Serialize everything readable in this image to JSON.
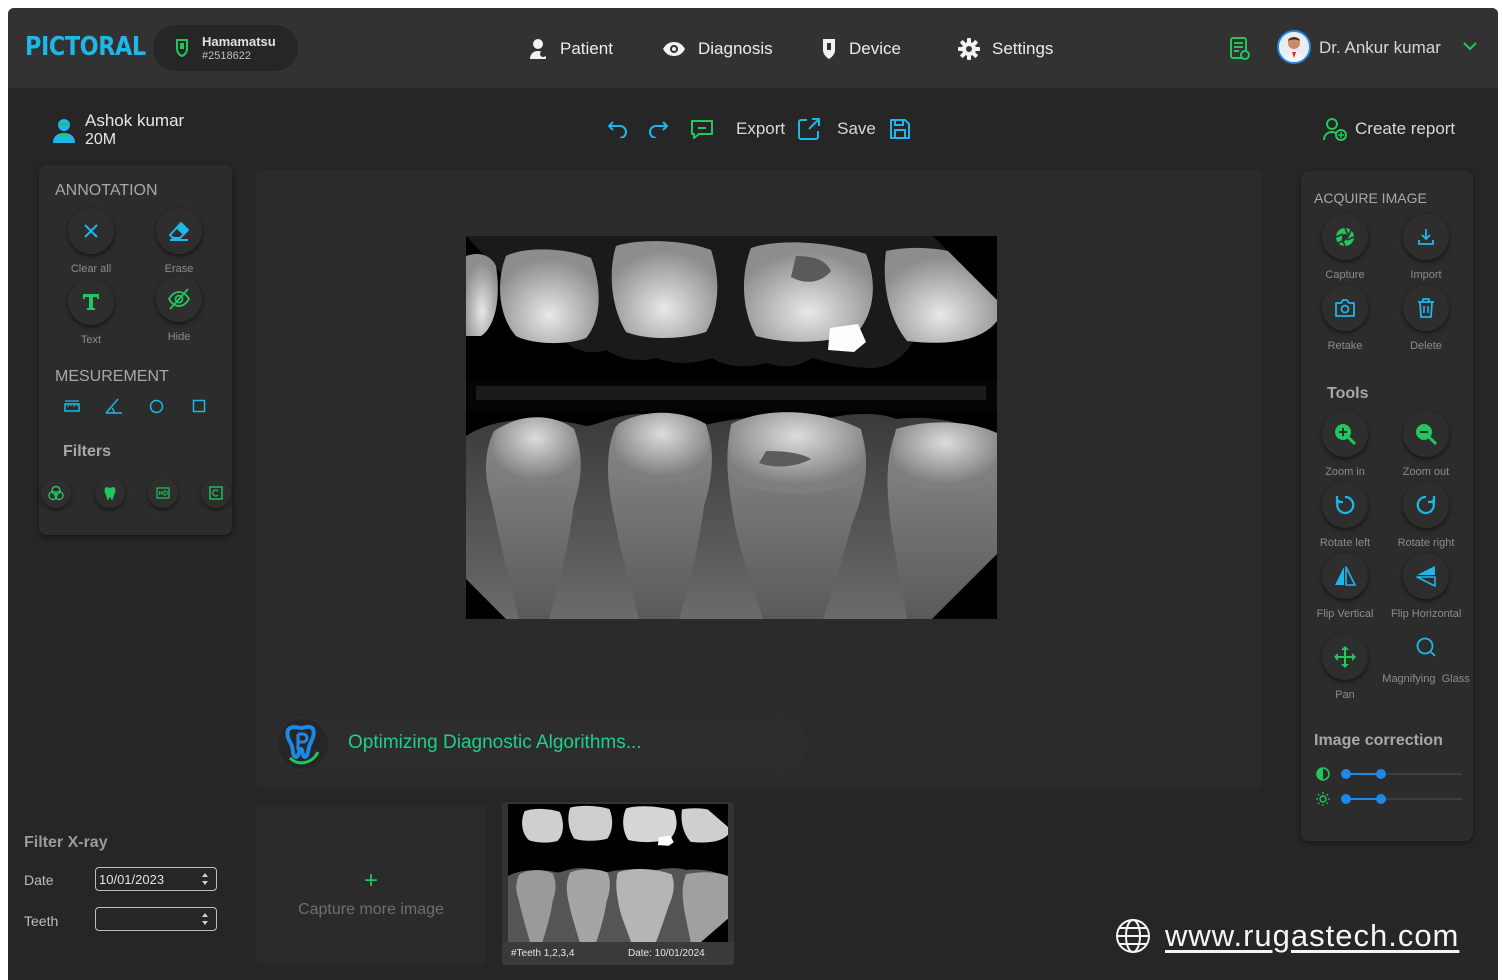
{
  "header": {
    "logo": "PICTORAL",
    "device": {
      "name": "Hamamatsu",
      "id": "#2518622"
    },
    "nav": [
      {
        "label": "Patient",
        "icon": "user-icon"
      },
      {
        "label": "Diagnosis",
        "icon": "eye-icon"
      },
      {
        "label": "Device",
        "icon": "sensor-icon"
      },
      {
        "label": "Settings",
        "icon": "gear-icon"
      }
    ],
    "user_name": "Dr. Ankur kumar"
  },
  "patient": {
    "name": "Ashok kumar",
    "info": "20M"
  },
  "toolbar": {
    "export": "Export",
    "save": "Save",
    "create_report": "Create report"
  },
  "left_panel": {
    "annotation_title": "ANNOTATION",
    "annotation_tools": [
      "Clear all",
      "Erase",
      "Text",
      "Hide"
    ],
    "measurement_title": "MESUREMENT",
    "filters_title": "Filters"
  },
  "right_panel": {
    "acquire_title": "ACQUIRE IMAGE",
    "acquire_tools": [
      "Capture",
      "Import",
      "Retake",
      "Delete"
    ],
    "tools_title": "Tools",
    "tools": [
      "Zoom in",
      "Zoom out",
      "Rotate left",
      "Rotate right",
      "Flip Vertical",
      "Flip Horizontal",
      "Pan",
      "Magnifying  Glass"
    ],
    "correction_title": "Image correction",
    "contrast_level": 0.3,
    "brightness_level": 0.3
  },
  "status": {
    "text": "Optimizing Diagnostic Algorithms..."
  },
  "filter_xray": {
    "title": "Filter X-ray",
    "date_label": "Date",
    "date_value": "10/01/2023",
    "teeth_label": "Teeth",
    "teeth_value": ""
  },
  "capture_more": {
    "plus": "+",
    "label": "Capture more image"
  },
  "thumbnail": {
    "teeth": "#Teeth 1,2,3,4",
    "date": "Date: 10/01/2024"
  },
  "footer": {
    "website": "www.rugastech.com"
  },
  "colors": {
    "accent_teal": "#1fb6e8",
    "accent_green": "#1fcf8a",
    "background": "#262626"
  }
}
